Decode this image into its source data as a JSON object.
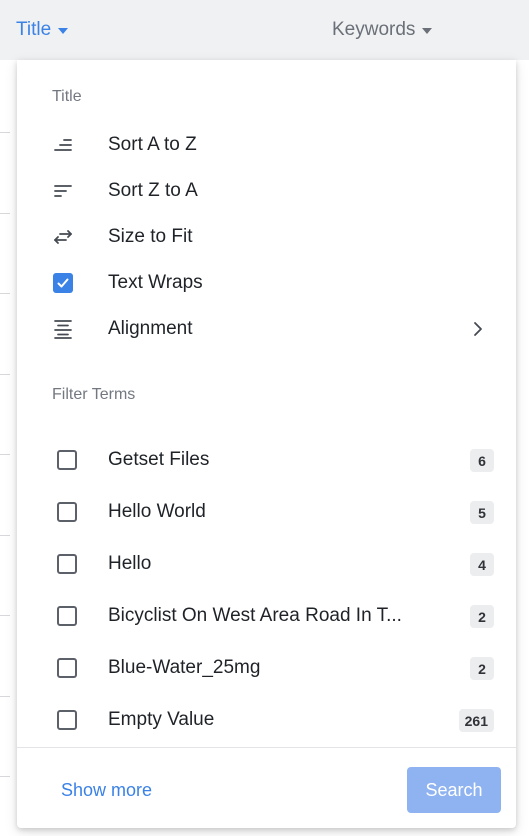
{
  "header": {
    "title_column": "Title",
    "keywords_column": "Keywords"
  },
  "menu": {
    "section_title": "Title",
    "items": [
      {
        "label": "Sort A to Z",
        "icon": "sort-ascending-icon"
      },
      {
        "label": "Sort Z to A",
        "icon": "sort-descending-icon"
      },
      {
        "label": "Size to Fit",
        "icon": "size-to-fit-icon"
      },
      {
        "label": "Text Wraps",
        "icon": "checkbox-checked-icon",
        "checked": true
      },
      {
        "label": "Alignment",
        "icon": "align-center-icon",
        "submenu": true
      }
    ],
    "filter_section_title": "Filter Terms",
    "filters": [
      {
        "label": "Getset Files",
        "count": "6",
        "checked": false
      },
      {
        "label": "Hello World",
        "count": "5",
        "checked": false
      },
      {
        "label": "Hello",
        "count": "4",
        "checked": false
      },
      {
        "label": "Bicyclist On West Area Road In T...",
        "count": "2",
        "checked": false
      },
      {
        "label": "Blue-Water_25mg",
        "count": "2",
        "checked": false
      },
      {
        "label": "Empty Value",
        "count": "261",
        "checked": false
      }
    ],
    "show_more_label": "Show more",
    "search_label": "Search"
  },
  "colors": {
    "accent": "#3b82e6",
    "search_button": "#8fb3f0",
    "header_bg": "#f0f1f3"
  }
}
